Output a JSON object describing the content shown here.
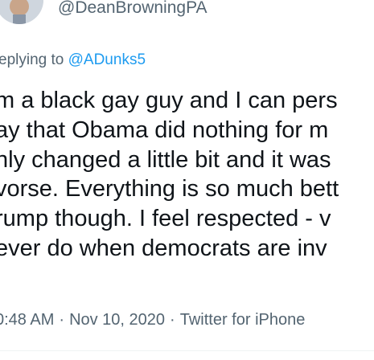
{
  "author": {
    "handle": "@DeanBrowningPA"
  },
  "reply": {
    "prefix": "eplying to",
    "mention": "@ADunks5"
  },
  "tweet": {
    "lines": [
      "m a black gay guy and I can pers",
      "ay that Obama did nothing for m",
      "nly changed a little bit and it was",
      "vorse. Everything is so much bett",
      "rump though. I feel respected - v",
      "ever do when democrats are inv"
    ]
  },
  "meta": {
    "time": "0:48 AM",
    "date": "Nov 10, 2020",
    "source": "Twitter for iPhone",
    "separator": "·"
  },
  "colors": {
    "text": "#0f1419",
    "secondary": "#536471",
    "link": "#1d9bf0"
  }
}
